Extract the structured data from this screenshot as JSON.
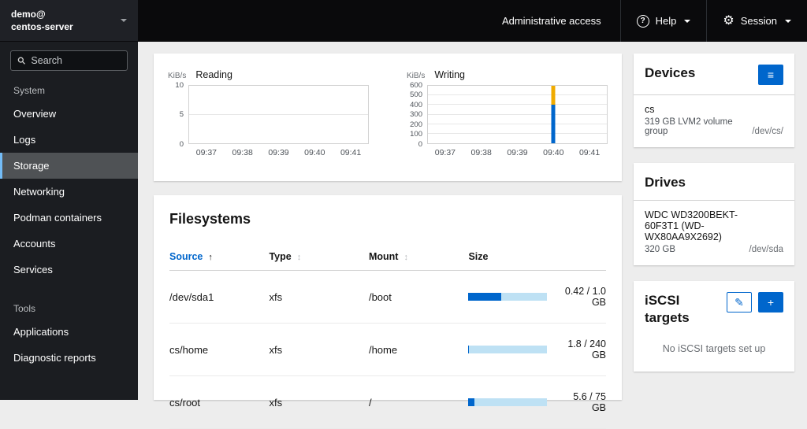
{
  "host": {
    "user": "demo@",
    "name": "centos-server"
  },
  "masthead": {
    "admin_access_label": "Administrative access",
    "help_label": "Help",
    "session_label": "Session"
  },
  "icons": {
    "help": "?",
    "gear": "⚙",
    "menu": "≡",
    "edit": "✎",
    "add": "+",
    "sort_asc": "↑",
    "sort_both": "↕"
  },
  "sidebar": {
    "search_placeholder": "Search",
    "system_label": "System",
    "tools_label": "Tools",
    "system_items": [
      "Overview",
      "Logs",
      "Storage",
      "Networking",
      "Podman containers",
      "Accounts",
      "Services"
    ],
    "tools_items": [
      "Applications",
      "Diagnostic reports"
    ],
    "active_item": "Storage"
  },
  "chart_data": [
    {
      "type": "line",
      "title": "Reading",
      "ylabel": "KiB/s",
      "x": [
        "09:37",
        "09:38",
        "09:39",
        "09:40",
        "09:41"
      ],
      "ylim": [
        0,
        10
      ],
      "yticks": [
        0,
        5,
        10
      ],
      "series": [
        {
          "name": "read",
          "color": "#0066cc",
          "values": [
            0,
            0,
            0,
            0,
            0
          ]
        }
      ],
      "grid": true,
      "legend": "none"
    },
    {
      "type": "bar",
      "title": "Writing",
      "ylabel": "KiB/s",
      "x": [
        "09:37",
        "09:38",
        "09:39",
        "09:40",
        "09:41"
      ],
      "ylim": [
        0,
        600
      ],
      "yticks": [
        0,
        100,
        200,
        300,
        400,
        500,
        600
      ],
      "series": [
        {
          "name": "write-base",
          "color": "#0066cc",
          "values": [
            0,
            0,
            0,
            400,
            0
          ]
        },
        {
          "name": "write-peak",
          "color": "#f0ab00",
          "values": [
            0,
            0,
            0,
            200,
            0
          ]
        }
      ],
      "grid": true,
      "legend": "none"
    }
  ],
  "filesystems": {
    "title": "Filesystems",
    "columns": [
      "Source",
      "Type",
      "Mount",
      "Size"
    ],
    "rows": [
      {
        "source": "/dev/sda1",
        "type": "xfs",
        "mount": "/boot",
        "used_pct": 42,
        "size_label": "0.42 / 1.0 GB"
      },
      {
        "source": "cs/home",
        "type": "xfs",
        "mount": "/home",
        "used_pct": 1,
        "size_label": "1.8 / 240 GB"
      },
      {
        "source": "cs/root",
        "type": "xfs",
        "mount": "/",
        "used_pct": 7.5,
        "size_label": "5.6 / 75 GB"
      }
    ]
  },
  "devices": {
    "title": "Devices",
    "items": [
      {
        "name": "cs",
        "desc": "319 GB LVM2 volume group",
        "path": "/dev/cs/"
      }
    ]
  },
  "drives": {
    "title": "Drives",
    "items": [
      {
        "name": "WDC WD3200BEKT-60F3T1 (WD-WX80AA9X2692)",
        "size": "320 GB",
        "path": "/dev/sda"
      }
    ]
  },
  "iscsi": {
    "title": "iSCSI targets",
    "empty": "No iSCSI targets set up"
  }
}
